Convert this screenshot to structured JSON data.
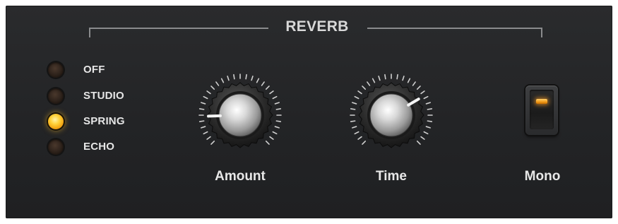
{
  "section": {
    "title": "REVERB"
  },
  "modes": [
    {
      "label": "OFF",
      "active": false
    },
    {
      "label": "STUDIO",
      "active": false
    },
    {
      "label": "SPRING",
      "active": true
    },
    {
      "label": "ECHO",
      "active": false
    }
  ],
  "knobs": [
    {
      "label": "Amount",
      "value": 0.16
    },
    {
      "label": "Time",
      "value": 0.72
    }
  ],
  "mono": {
    "label": "Mono",
    "on": true
  },
  "colors": {
    "led_on": "#ffd23a",
    "led_off": "#2c211a",
    "lamp": "#f29a18",
    "text": "#e6e6e6"
  }
}
